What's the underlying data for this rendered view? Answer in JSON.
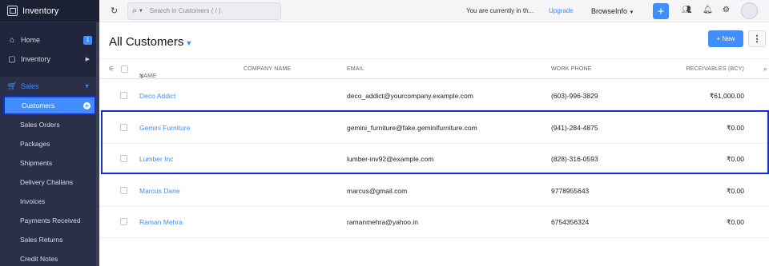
{
  "app": {
    "title": "Inventory"
  },
  "sidebar": {
    "home": {
      "label": "Home",
      "badge": "1"
    },
    "inventory": {
      "label": "Inventory"
    },
    "sales": {
      "label": "Sales"
    },
    "items": [
      {
        "label": "Customers"
      },
      {
        "label": "Sales Orders"
      },
      {
        "label": "Packages"
      },
      {
        "label": "Shipments"
      },
      {
        "label": "Delivery Challans"
      },
      {
        "label": "Invoices"
      },
      {
        "label": "Payments Received"
      },
      {
        "label": "Sales Returns"
      },
      {
        "label": "Credit Notes"
      }
    ]
  },
  "topbar": {
    "search_placeholder": "Search in Customers ( / )",
    "info": "You are currently in th...",
    "upgrade": "Upgrade",
    "org": "BrowseInfo"
  },
  "page": {
    "title": "All Customers",
    "new_button": "+ New"
  },
  "table": {
    "columns": {
      "name": "NAME",
      "company": "COMPANY NAME",
      "email": "EMAIL",
      "phone": "WORK PHONE",
      "receivables": "RECEIVABLES (BCY)"
    },
    "rows": [
      {
        "name": "Deco Addict",
        "company": "",
        "email": "deco_addict@yourcompany.example.com",
        "phone": "(603)-996-3829",
        "receivables": "₹61,000.00"
      },
      {
        "name": "Gemini Furniture",
        "company": "",
        "email": "gemini_furniture@fake.geminifurniture.com",
        "phone": "(941)-284-4875",
        "receivables": "₹0.00"
      },
      {
        "name": "Lumber Inc",
        "company": "",
        "email": "lumber-inv92@example.com",
        "phone": "(828)-316-0593",
        "receivables": "₹0.00"
      },
      {
        "name": "Marcus Dane",
        "company": "",
        "email": "marcus@gmail.com",
        "phone": "9778955643",
        "receivables": "₹0.00"
      },
      {
        "name": "Raman Mehra",
        "company": "",
        "email": "ramanmehra@yahoo.in",
        "phone": "6754356324",
        "receivables": "₹0.00"
      }
    ]
  },
  "colors": {
    "accent": "#408dfb",
    "sidebar_bg": "#21263c",
    "highlight": "#1530d0"
  }
}
